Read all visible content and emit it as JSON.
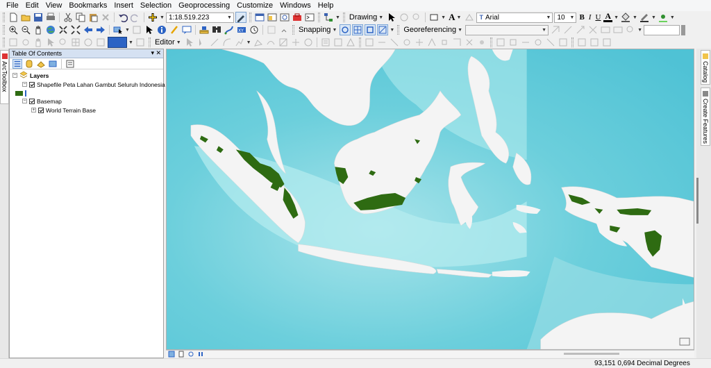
{
  "menu": [
    "File",
    "Edit",
    "View",
    "Bookmarks",
    "Insert",
    "Selection",
    "Geoprocessing",
    "Customize",
    "Windows",
    "Help"
  ],
  "toolbar": {
    "scale": "1:18.519.223",
    "drawing_label": "Drawing",
    "font_name": "Arial",
    "font_size": "10",
    "bold": "B",
    "italic": "I",
    "underline": "U",
    "font_color_letter": "A",
    "text_tool_letter": "A",
    "snapping_label": "Snapping",
    "georeferencing_label": "Georeferencing",
    "editor_label": "Editor"
  },
  "toc": {
    "title": "Table Of Contents",
    "pin": "▾ ✕",
    "layers_label": "Layers",
    "layer1": "Shapefile Peta Lahan Gambut Seluruh Indonesia",
    "basemap_label": "Basemap",
    "basemap_layer": "World Terrain Base"
  },
  "side_tabs": {
    "left": "ArcToolbox",
    "right1": "Catalog",
    "right2": "Create Features"
  },
  "status": {
    "coordinates": "93,151  0,694 Decimal Degrees"
  },
  "colors": {
    "sea": "#74cfdc",
    "deep_sea": "#8fd7e2",
    "land": "#f4f4f4",
    "peat": "#2e6b12",
    "toc_header": "#d5e1f2"
  }
}
